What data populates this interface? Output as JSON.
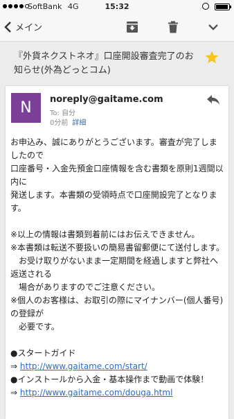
{
  "status_bar": {
    "carrier": "SoftBank",
    "network": "4G",
    "time": "15:32",
    "battery_level": 0.95
  },
  "nav": {
    "back_label": "メイン",
    "icons": [
      "chevron-left-icon",
      "archive-icon",
      "trash-icon",
      "chevron-down-icon"
    ]
  },
  "email": {
    "subject": "『外貨ネクストネオ』口座開設審査完了のお知らせ(外為どっとコム)",
    "starred": true,
    "avatar_letter": "N",
    "avatar_color": "#7b3f98",
    "sender": "noreply@gaitame.com",
    "to_line": "To: 自分",
    "time_ago": "0分前",
    "details_label": "詳細",
    "body": {
      "p1": "お申込み、誠にありがとうございます。審査が完了しましたので\n口座番号・入金先預金口座情報を含む書類を原則1週間以内に\n発送します。本書類の受領時点で口座開設完了となります。",
      "p2": "※以上の情報は書類到着前にはお伝えできません。\n※本書類は転送不要扱いの簡易書留郵便にて送付します。\n　お受け取りがないまま一定期間を経過しますと弊社へ返送される\n　場合がありますのでご注意ください。\n※個人のお客様は、お取引の際にマイナンバー(個人番号)の登録が\n　必要です。",
      "guide_label": "●スタートガイド",
      "guide_arrow": "⇒",
      "guide_link": "http://www.gaitame.com/start/",
      "video_label": "●インストールから入金・基本操作まで動画で体験！",
      "video_arrow": "⇒",
      "video_link": "http://www.gaitame.com/douga.html"
    }
  }
}
